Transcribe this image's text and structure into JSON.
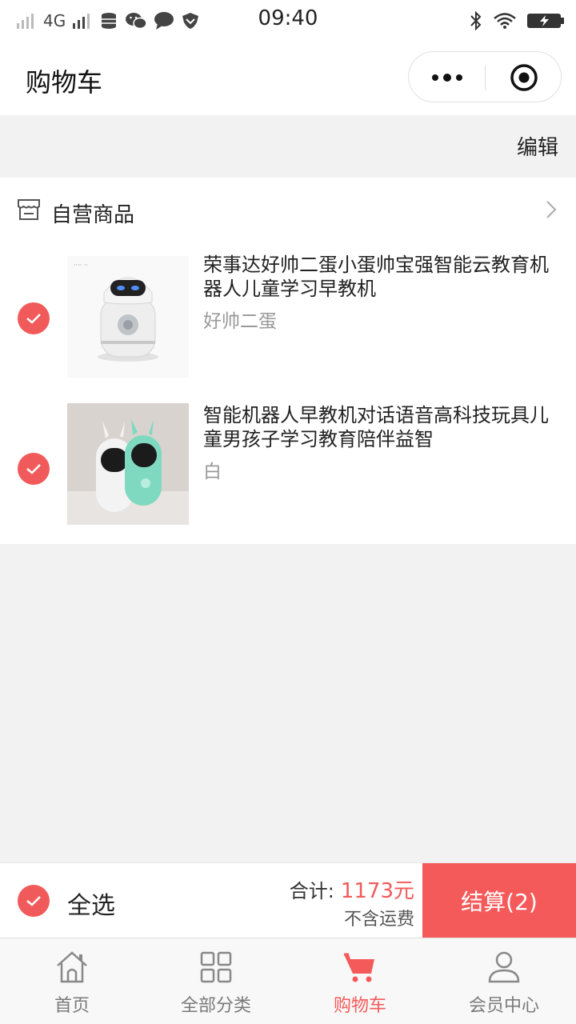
{
  "status_bar": {
    "network": "4G",
    "time": "09:40"
  },
  "nav": {
    "title": "购物车"
  },
  "edit_label": "编辑",
  "store": {
    "name": "自营商品"
  },
  "items": [
    {
      "title": "荣事达好帅二蛋小蛋帅宝强智能云教育机器人儿童学习早教机",
      "spec": "好帅二蛋",
      "checked": true
    },
    {
      "title": "智能机器人早教机对话语音高科技玩具儿童男孩子学习教育陪伴益智",
      "spec": "白",
      "checked": true
    }
  ],
  "checkout": {
    "select_all_label": "全选",
    "total_label": "合计:",
    "total_amount": "1173元",
    "shipping_note": "不含运费",
    "button_label": "结算(2)"
  },
  "tabs": [
    {
      "label": "首页",
      "icon": "home-icon",
      "active": false
    },
    {
      "label": "全部分类",
      "icon": "grid-icon",
      "active": false
    },
    {
      "label": "购物车",
      "icon": "cart-icon",
      "active": true
    },
    {
      "label": "会员中心",
      "icon": "user-icon",
      "active": false
    }
  ],
  "colors": {
    "accent": "#f55a5a",
    "check": "#f15a5a",
    "background": "#f2f2f2"
  }
}
